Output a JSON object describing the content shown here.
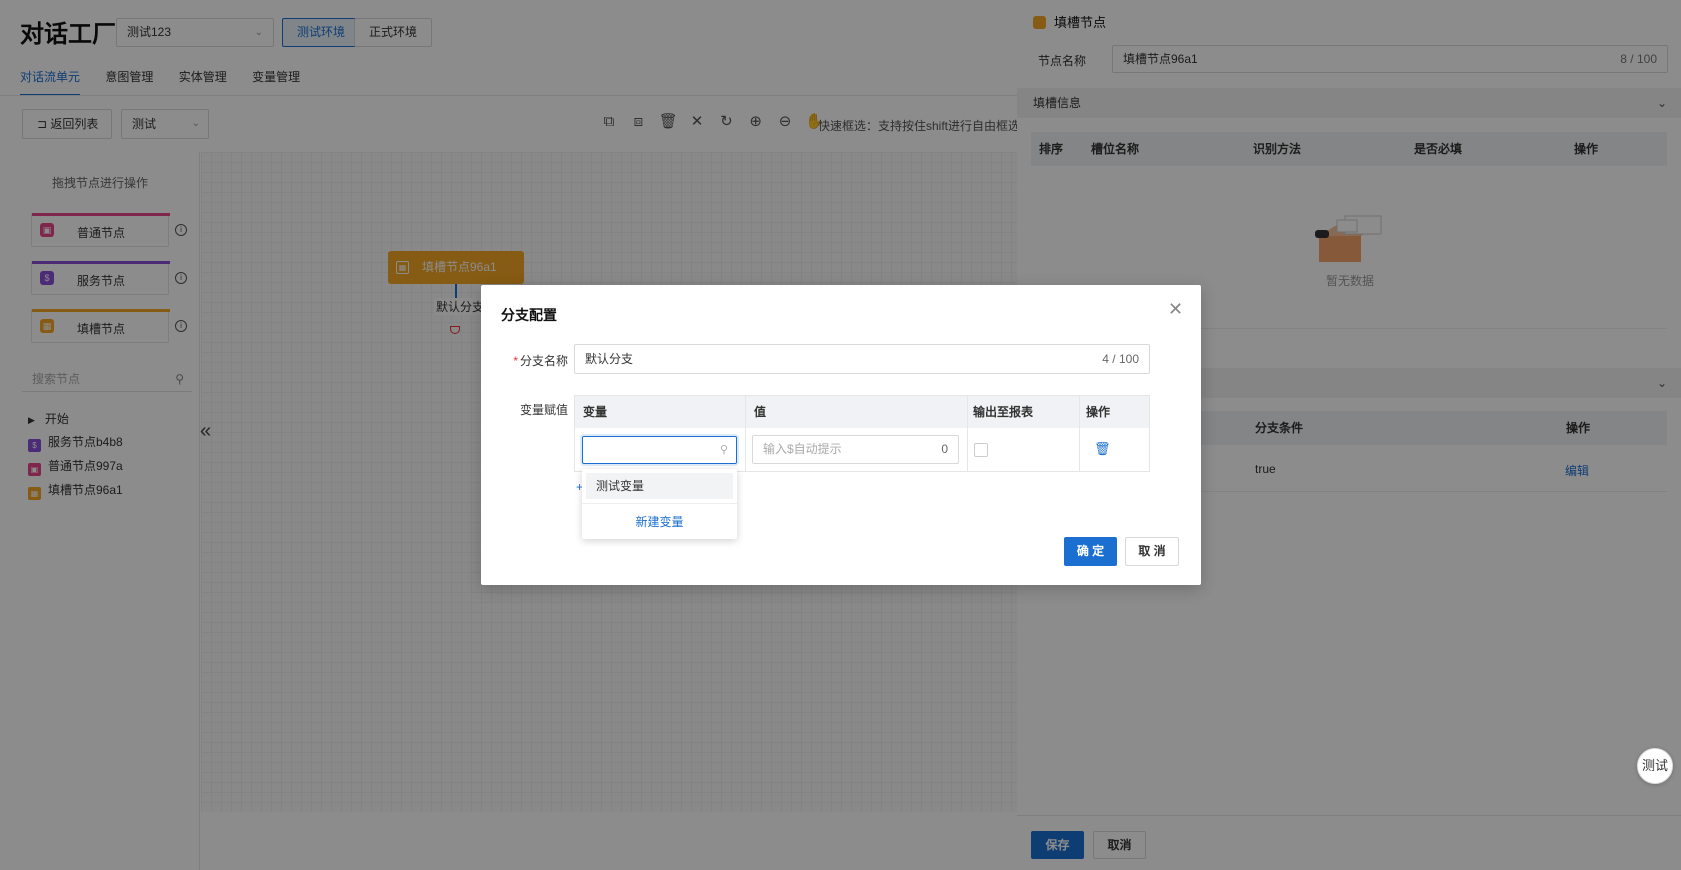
{
  "header": {
    "app_title": "对话工厂",
    "env_select": "测试123",
    "env_tabs": [
      "测试环境",
      "正式环境"
    ],
    "nav_tabs": [
      "对话流单元",
      "意图管理",
      "实体管理",
      "变量管理"
    ]
  },
  "toolbar": {
    "back_label": "返回列表",
    "select_value": "测试",
    "hint": "快速框选：支持按住shift进行自由框选"
  },
  "left_panel": {
    "hint": "拖拽节点进行操作",
    "node_types": [
      {
        "label": "普通节点",
        "color": "#e8458b"
      },
      {
        "label": "服务节点",
        "color": "#8a4fd8"
      },
      {
        "label": "填槽节点",
        "color": "#f5a623"
      }
    ],
    "search_placeholder": "搜索节点",
    "tree": [
      "开始",
      "服务节点b4b8",
      "普通节点997a",
      "填槽节点96a1"
    ]
  },
  "canvas": {
    "node_label": "填槽节点96a1",
    "branch_label": "默认分支"
  },
  "drawer": {
    "title": "填槽节点",
    "name_label": "节点名称",
    "name_value": "填槽节点96a1",
    "name_count": "8 / 100",
    "section1": "填槽信息",
    "slot_columns": [
      "排序",
      "槽位名称",
      "识别方法",
      "是否必填",
      "操作"
    ],
    "empty_text": "暂无数据",
    "branch_columns": [
      "分支条件",
      "操作"
    ],
    "branch_row": {
      "condition": "true",
      "action": "编辑"
    },
    "save_label": "保存",
    "cancel_label": "取消"
  },
  "modal": {
    "title": "分支配置",
    "name_label": "分支名称",
    "name_value": "默认分支",
    "name_count": "4 / 100",
    "assign_label": "变量赋值",
    "columns": [
      "变量",
      "值",
      "输出至报表",
      "操作"
    ],
    "value_placeholder": "输入$自动提示",
    "value_count": "0",
    "add_label": "+",
    "ok_label": "确 定",
    "cancel_label": "取 消",
    "dropdown": {
      "option": "测试变量",
      "create": "新建变量"
    }
  },
  "fab_label": "测试",
  "colors": {
    "primary": "#1a6fd1",
    "slot_orange": "#f5a623",
    "danger": "#e33333"
  }
}
